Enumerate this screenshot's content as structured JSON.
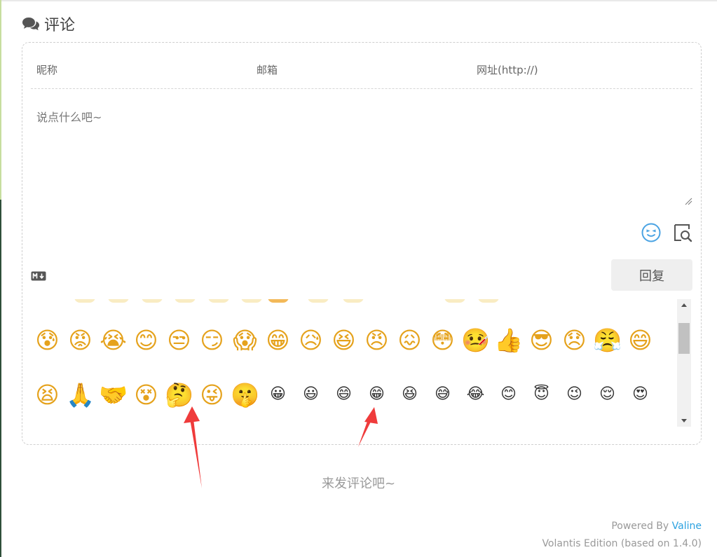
{
  "section": {
    "icon": "comments-icon",
    "title": "评论"
  },
  "form": {
    "nick_placeholder": "昵称",
    "mail_placeholder": "邮箱",
    "link_placeholder": "网址(http://)",
    "comment_placeholder": "说点什么吧~",
    "emoji_toggle_icon": "smiley-face-icon",
    "preview_toggle_icon": "preview-search-icon",
    "markdown_icon": "markdown-icon",
    "reply_label": "回复"
  },
  "emoji_panel": {
    "row_1": [
      "😰",
      "😡",
      "😭",
      "😊",
      "😒",
      "😏",
      "😱",
      "😁",
      "😥",
      "😆",
      "😠",
      "😖",
      "😳",
      "🤒",
      "👍",
      "😎",
      "😞",
      "😤",
      "😄"
    ],
    "row_2": [
      "😫",
      "🙏",
      "🤝",
      "😵",
      "🤔",
      "😜",
      "🤫",
      "😀",
      "😃",
      "😄",
      "😁",
      "😆",
      "😅",
      "😂",
      "😊",
      "😇",
      "😉",
      "😌",
      "😍"
    ]
  },
  "colors": {
    "accent": "#2aa1e0",
    "annotation_arrow": "#ef3b3b",
    "reply_button_bg": "#efefef"
  },
  "footer": {
    "empty_hint": "来发评论吧~",
    "powered_by": "Powered By",
    "brand": "Valine",
    "edition": "Volantis Edition (based on 1.4.0)"
  }
}
